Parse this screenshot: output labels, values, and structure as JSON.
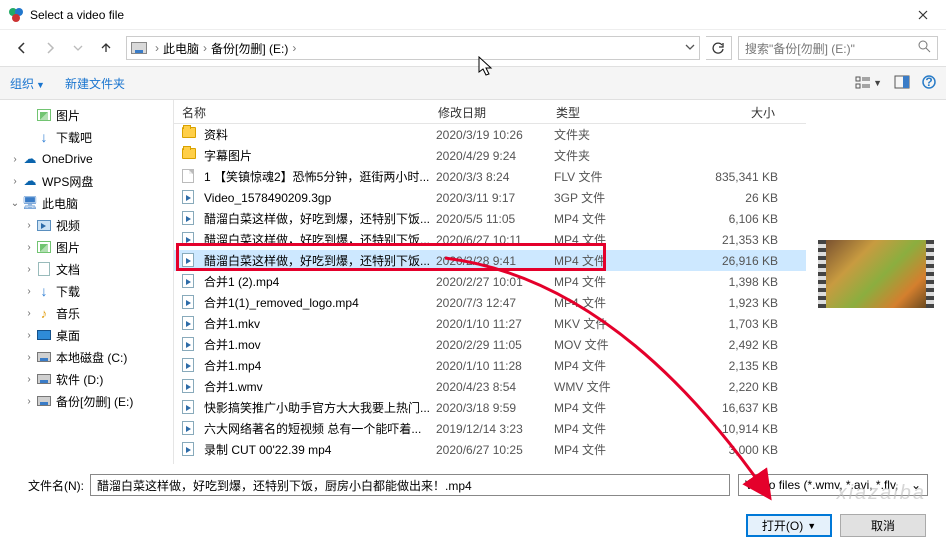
{
  "title": "Select a video file",
  "breadcrumb": {
    "root": "此电脑",
    "folder": "备份[勿删] (E:)"
  },
  "search_placeholder": "搜索\"备份[勿删] (E:)\"",
  "toolbar": {
    "organize": "组织",
    "newfolder": "新建文件夹"
  },
  "tree": [
    {
      "icon": "img",
      "label": "图片",
      "indent": 1,
      "exp": ""
    },
    {
      "icon": "dl",
      "label": "下载吧",
      "indent": 1,
      "exp": ""
    },
    {
      "icon": "cloud",
      "label": "OneDrive",
      "indent": 0,
      "exp": "›"
    },
    {
      "icon": "cloud",
      "label": "WPS网盘",
      "indent": 0,
      "exp": "›"
    },
    {
      "icon": "pc",
      "label": "此电脑",
      "indent": 0,
      "exp": "⌄"
    },
    {
      "icon": "vid",
      "label": "视频",
      "indent": 1,
      "exp": "›"
    },
    {
      "icon": "img",
      "label": "图片",
      "indent": 1,
      "exp": "›"
    },
    {
      "icon": "doc",
      "label": "文档",
      "indent": 1,
      "exp": "›"
    },
    {
      "icon": "dl",
      "label": "下载",
      "indent": 1,
      "exp": "›"
    },
    {
      "icon": "music",
      "label": "音乐",
      "indent": 1,
      "exp": "›"
    },
    {
      "icon": "desk",
      "label": "桌面",
      "indent": 1,
      "exp": "›"
    },
    {
      "icon": "disk",
      "label": "本地磁盘 (C:)",
      "indent": 1,
      "exp": "›"
    },
    {
      "icon": "disk",
      "label": "软件 (D:)",
      "indent": 1,
      "exp": "›"
    },
    {
      "icon": "disk",
      "label": "备份[勿删] (E:)",
      "indent": 1,
      "exp": "›"
    }
  ],
  "columns": {
    "name": "名称",
    "date": "修改日期",
    "type": "类型",
    "size": "大小"
  },
  "rows": [
    {
      "ic": "folder",
      "name": "资料",
      "date": "2020/3/19 10:26",
      "type": "文件夹",
      "size": ""
    },
    {
      "ic": "folder",
      "name": "字幕图片",
      "date": "2020/4/29 9:24",
      "type": "文件夹",
      "size": ""
    },
    {
      "ic": "file",
      "name": "1 【笑镇惊魂2】恐怖5分钟，逛街两小时...",
      "date": "2020/3/3 8:24",
      "type": "FLV 文件",
      "size": "835,341 KB"
    },
    {
      "ic": "media",
      "name": "Video_1578490209.3gp",
      "date": "2020/3/11 9:17",
      "type": "3GP 文件",
      "size": "26 KB"
    },
    {
      "ic": "media",
      "name": "醋溜白菜这样做，好吃到爆，还特别下饭...",
      "date": "2020/5/5 11:05",
      "type": "MP4 文件",
      "size": "6,106 KB"
    },
    {
      "ic": "media",
      "name": "醋溜白菜这样做，好吃到爆，还特别下饭...",
      "date": "2020/6/27 10:11",
      "type": "MP4 文件",
      "size": "21,353 KB"
    },
    {
      "ic": "media",
      "name": "醋溜白菜这样做，好吃到爆，还特别下饭...",
      "date": "2020/2/28 9:41",
      "type": "MP4 文件",
      "size": "26,916 KB",
      "sel": true
    },
    {
      "ic": "media",
      "name": "合并1 (2).mp4",
      "date": "2020/2/27 10:01",
      "type": "MP4 文件",
      "size": "1,398 KB"
    },
    {
      "ic": "media",
      "name": "合并1(1)_removed_logo.mp4",
      "date": "2020/7/3 12:47",
      "type": "MP4 文件",
      "size": "1,923 KB"
    },
    {
      "ic": "media",
      "name": "合并1.mkv",
      "date": "2020/1/10 11:27",
      "type": "MKV 文件",
      "size": "1,703 KB"
    },
    {
      "ic": "media",
      "name": "合并1.mov",
      "date": "2020/2/29 11:05",
      "type": "MOV 文件",
      "size": "2,492 KB"
    },
    {
      "ic": "media",
      "name": "合并1.mp4",
      "date": "2020/1/10 11:28",
      "type": "MP4 文件",
      "size": "2,135 KB"
    },
    {
      "ic": "media",
      "name": "合并1.wmv",
      "date": "2020/4/23 8:54",
      "type": "WMV 文件",
      "size": "2,220 KB"
    },
    {
      "ic": "media",
      "name": "快影搞笑推广小助手官方大大我要上热门...",
      "date": "2020/3/18 9:59",
      "type": "MP4 文件",
      "size": "16,637 KB"
    },
    {
      "ic": "media",
      "name": "六大网络著名的短视频 总有一个能吓着...",
      "date": "2019/12/14 3:23",
      "type": "MP4 文件",
      "size": "10,914 KB"
    },
    {
      "ic": "media",
      "name": "录制 CUT 00'22.39 mp4",
      "date": "2020/6/27 10:25",
      "type": "MP4 文件",
      "size": "3,000 KB"
    }
  ],
  "filename_label": "文件名(N):",
  "filename_value": "醋溜白菜这样做，好吃到爆，还特别下饭，厨房小白都能做出来！.mp4",
  "filter_label": "Video files (*.wmv, *.avi, *.flv,",
  "open_btn": "打开(O)",
  "cancel_btn": "取消",
  "watermark": "xiazaiba"
}
